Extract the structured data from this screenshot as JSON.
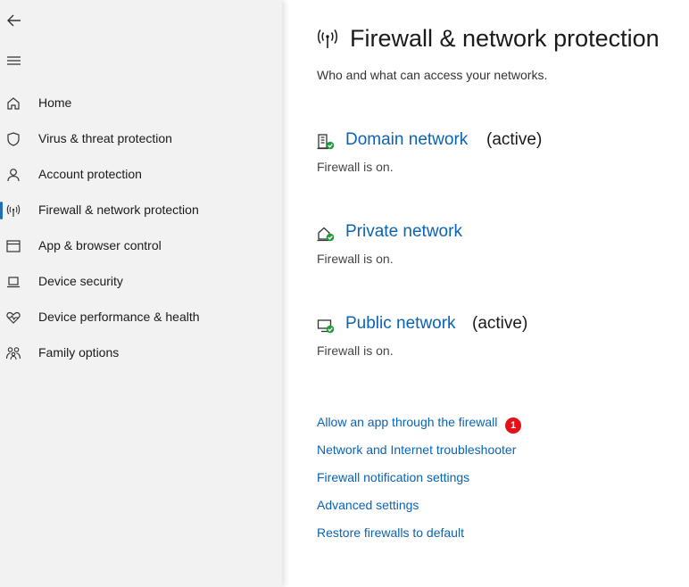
{
  "sidebar": {
    "back_icon": "back-arrow-icon",
    "menu_icon": "hamburger-menu-icon",
    "items": [
      {
        "label": "Home",
        "icon": "home-icon"
      },
      {
        "label": "Virus & threat protection",
        "icon": "shield-icon"
      },
      {
        "label": "Account protection",
        "icon": "person-icon"
      },
      {
        "label": "Firewall & network protection",
        "icon": "antenna-icon",
        "selected": true
      },
      {
        "label": "App & browser control",
        "icon": "browser-window-icon"
      },
      {
        "label": "Device security",
        "icon": "laptop-icon"
      },
      {
        "label": "Device performance & health",
        "icon": "heart-pulse-icon"
      },
      {
        "label": "Family options",
        "icon": "family-icon"
      }
    ]
  },
  "main": {
    "title": "Firewall & network protection",
    "subtitle": "Who and what can access your networks.",
    "networks": [
      {
        "name": "Domain network",
        "active": "(active)",
        "status": "Firewall is on.",
        "icon": "domain-network-icon"
      },
      {
        "name": "Private network",
        "active": "",
        "status": "Firewall is on.",
        "icon": "private-network-icon"
      },
      {
        "name": "Public network",
        "active": "(active)",
        "status": "Firewall is on.",
        "icon": "public-network-icon"
      }
    ],
    "links": [
      "Allow an app through the firewall",
      "Network and Internet troubleshooter",
      "Firewall notification settings",
      "Advanced settings",
      "Restore firewalls to default"
    ],
    "annotation_badge": "1"
  },
  "colors": {
    "accent": "#0a63b5",
    "selection_bar": "#1f6fb5",
    "sidebar_bg": "#f2f2f2",
    "status_ok": "#1e9e3a",
    "badge": "#e4111b"
  }
}
